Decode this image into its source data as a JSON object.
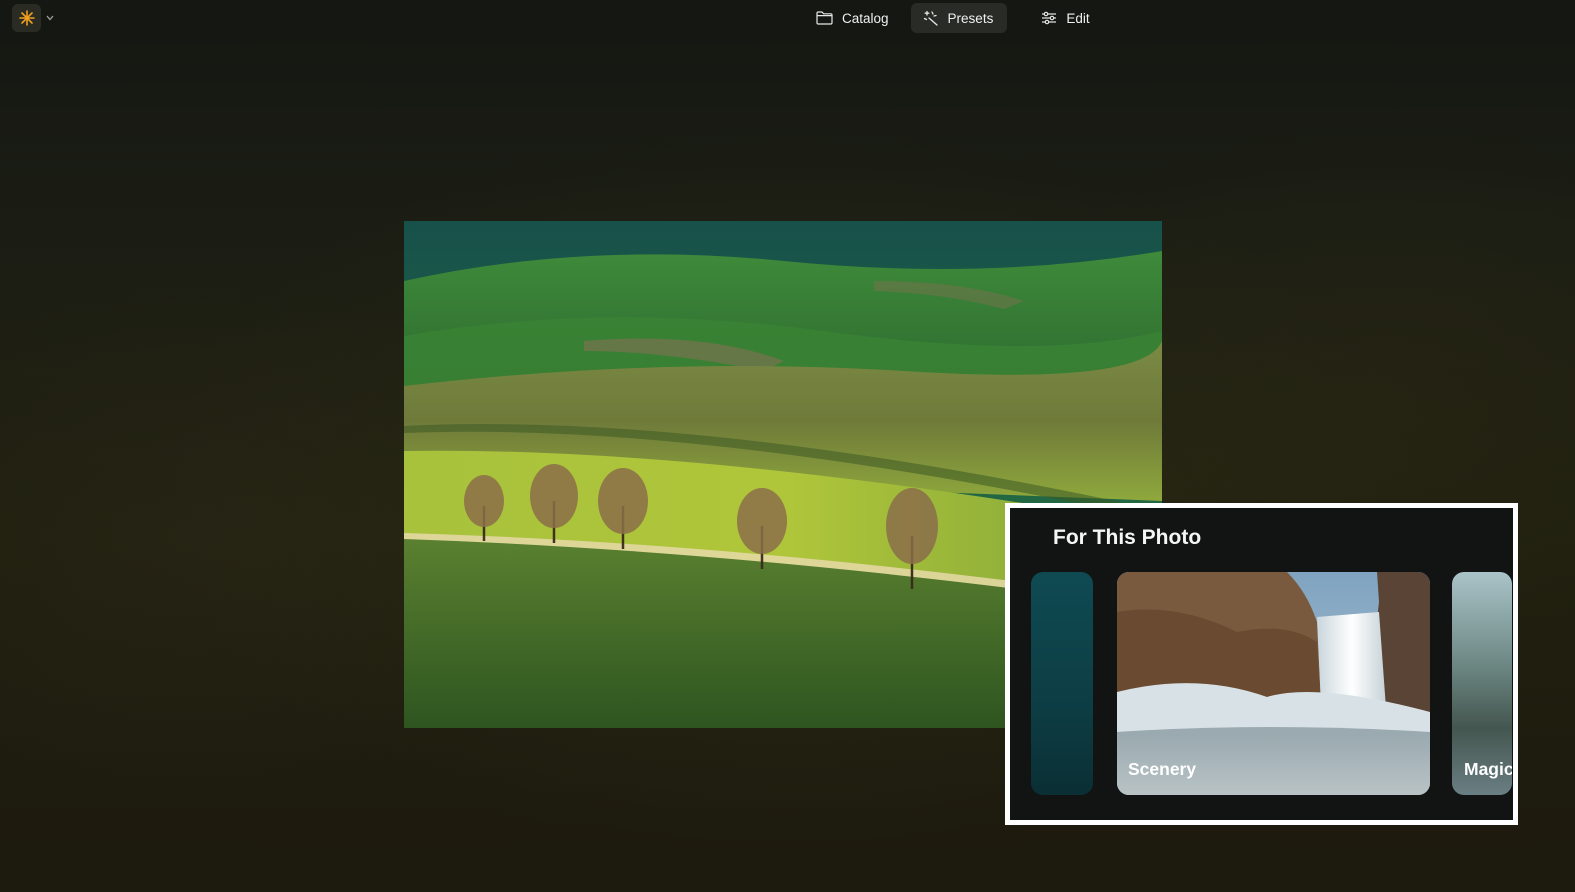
{
  "app": {
    "logo_icon": "sparkle-icon",
    "menu_icon": "chevron-down-icon",
    "accent": "#f0a020"
  },
  "nav": {
    "tabs": [
      {
        "label": "Catalog",
        "icon": "folder-icon",
        "active": false
      },
      {
        "label": "Presets",
        "icon": "magic-wand-icon",
        "active": true
      },
      {
        "label": "Edit",
        "icon": "sliders-icon",
        "active": false
      }
    ]
  },
  "photo": {
    "subject": "rolling green hills with row of trees"
  },
  "presets_panel": {
    "title": "For This Photo",
    "cards": [
      {
        "label": ""
      },
      {
        "label": "Scenery"
      },
      {
        "label": "Magic"
      }
    ]
  }
}
